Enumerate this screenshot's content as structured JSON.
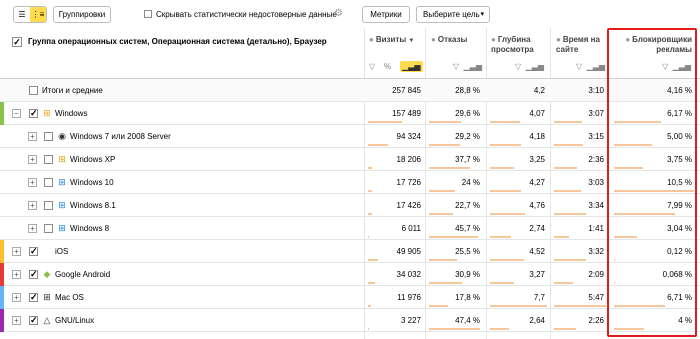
{
  "toolbar": {
    "view_list_icon": "list-icon",
    "view_tree_icon": "tree-icon",
    "groupings_label": "Группировки",
    "hide_unreliable_label": "Скрывать статистически недостоверные данные",
    "metrics_label": "Метрики",
    "goal_label": "Выберите цель"
  },
  "header": {
    "group_title": "Группа операционных систем, Операционная система (детально), Браузер",
    "columns": [
      {
        "label": "Визиты",
        "sort": "▼"
      },
      {
        "label": "Отказы"
      },
      {
        "label": "Глубина просмотра"
      },
      {
        "label": "Время на сайте"
      },
      {
        "label": "Блокировщики рекламы"
      }
    ],
    "percent_symbol": "%"
  },
  "rows": [
    {
      "name": "Итоги и средние",
      "visits": "257 845",
      "bounce": "28,8 %",
      "depth": "4,2",
      "time": "3:10",
      "adblock": "4,16 %"
    },
    {
      "name": "Windows",
      "visits": "157 489",
      "bounce": "29,6 %",
      "depth": "4,07",
      "time": "3:07",
      "adblock": "6,17 %",
      "icon": "windows-flag-icon",
      "color": "#8bc34a"
    },
    {
      "name": "Windows 7 или 2008 Server",
      "visits": "94 324",
      "bounce": "29,2 %",
      "depth": "4,18",
      "time": "3:15",
      "adblock": "5,00 %",
      "icon": "windows7-icon"
    },
    {
      "name": "Windows XP",
      "visits": "18 206",
      "bounce": "37,7 %",
      "depth": "3,25",
      "time": "2:36",
      "adblock": "3,75 %",
      "icon": "windows-xp-icon"
    },
    {
      "name": "Windows 10",
      "visits": "17 726",
      "bounce": "24 %",
      "depth": "4,27",
      "time": "3:03",
      "adblock": "10,5 %",
      "icon": "windows10-icon"
    },
    {
      "name": "Windows 8.1",
      "visits": "17 426",
      "bounce": "22,7 %",
      "depth": "4,76",
      "time": "3:34",
      "adblock": "7,99 %",
      "icon": "windows81-icon"
    },
    {
      "name": "Windows 8",
      "visits": "6 011",
      "bounce": "45,7 %",
      "depth": "2,74",
      "time": "1:41",
      "adblock": "3,04 %",
      "icon": "windows8-icon"
    },
    {
      "name": "iOS",
      "visits": "49 905",
      "bounce": "25,5 %",
      "depth": "4,52",
      "time": "3:32",
      "adblock": "0,12 %",
      "icon": "apple-icon",
      "color": "#fbc02d"
    },
    {
      "name": "Google Android",
      "visits": "34 032",
      "bounce": "30,9 %",
      "depth": "3,27",
      "time": "2:09",
      "adblock": "0,068 %",
      "icon": "android-icon",
      "color": "#e53935"
    },
    {
      "name": "Mac OS",
      "visits": "11 976",
      "bounce": "17,8 %",
      "depth": "7,7",
      "time": "5:47",
      "adblock": "6,71 %",
      "icon": "mac-flag-icon",
      "color": "#64b5f6"
    },
    {
      "name": "GNU/Linux",
      "visits": "3 227",
      "bounce": "47,4 %",
      "depth": "2,64",
      "time": "2:26",
      "adblock": "4 %",
      "icon": "linux-icon",
      "color": "#9c27b0"
    }
  ],
  "bar_fractions": {
    "visits": [
      0.61,
      0.37,
      0.07,
      0.07,
      0.07,
      0.02,
      0.19,
      0.13,
      0.05,
      0.01
    ],
    "bounce": [
      0.59,
      0.58,
      0.75,
      0.48,
      0.45,
      0.91,
      0.51,
      0.62,
      0.36,
      0.95
    ],
    "depth": [
      0.53,
      0.54,
      0.42,
      0.55,
      0.62,
      0.36,
      0.59,
      0.42,
      1.0,
      0.34
    ],
    "time": [
      0.53,
      0.56,
      0.45,
      0.52,
      0.61,
      0.29,
      0.61,
      0.37,
      1.0,
      0.42
    ],
    "adblock": [
      0.59,
      0.48,
      0.36,
      1.0,
      0.76,
      0.29,
      0.01,
      0.01,
      0.64,
      0.38
    ]
  }
}
